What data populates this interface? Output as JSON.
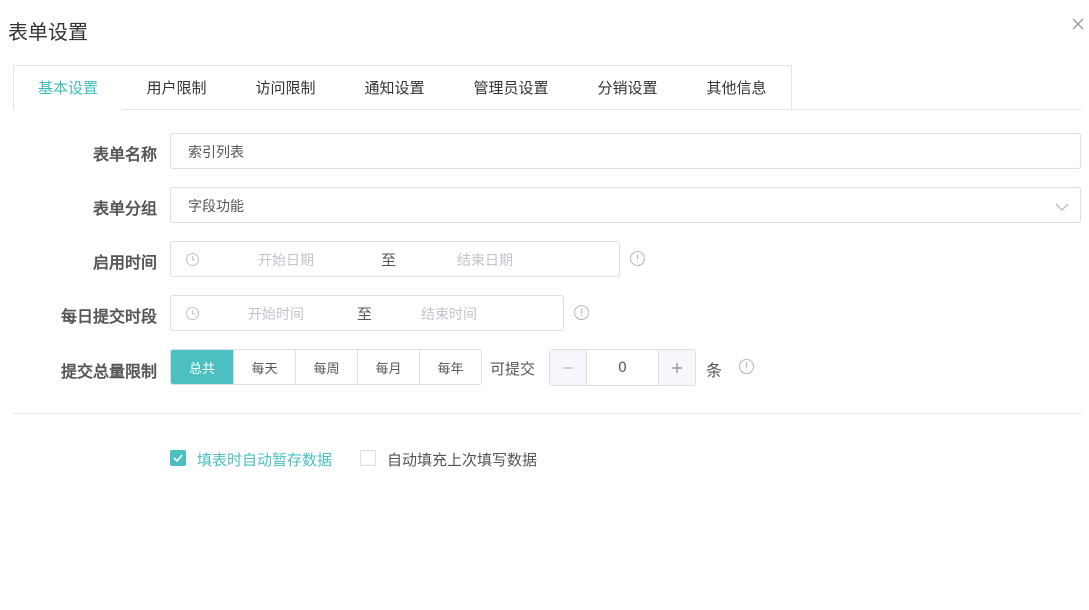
{
  "dialog": {
    "title": "表单设置"
  },
  "tabs": [
    {
      "label": "基本设置",
      "active": true
    },
    {
      "label": "用户限制",
      "active": false
    },
    {
      "label": "访问限制",
      "active": false
    },
    {
      "label": "通知设置",
      "active": false
    },
    {
      "label": "管理员设置",
      "active": false
    },
    {
      "label": "分销设置",
      "active": false
    },
    {
      "label": "其他信息",
      "active": false
    }
  ],
  "form": {
    "name": {
      "label": "表单名称",
      "value": "索引列表"
    },
    "group": {
      "label": "表单分组",
      "value": "字段功能"
    },
    "enable_time": {
      "label": "启用时间",
      "start_placeholder": "开始日期",
      "separator": "至",
      "end_placeholder": "结束日期"
    },
    "daily_period": {
      "label": "每日提交时段",
      "start_placeholder": "开始时间",
      "separator": "至",
      "end_placeholder": "结束时间"
    },
    "submit_limit": {
      "label": "提交总量限制",
      "periods": [
        "总共",
        "每天",
        "每周",
        "每月",
        "每年"
      ],
      "selected": "总共",
      "prefix": "可提交",
      "value": "0",
      "unit": "条"
    }
  },
  "options": {
    "autosave": {
      "label": "填表时自动暂存数据",
      "checked": true
    },
    "autofill": {
      "label": "自动填充上次填写数据",
      "checked": false
    }
  },
  "colors": {
    "accent": "#4cbfc0",
    "border": "#dcdfe6",
    "placeholder": "#c0c4cc"
  }
}
